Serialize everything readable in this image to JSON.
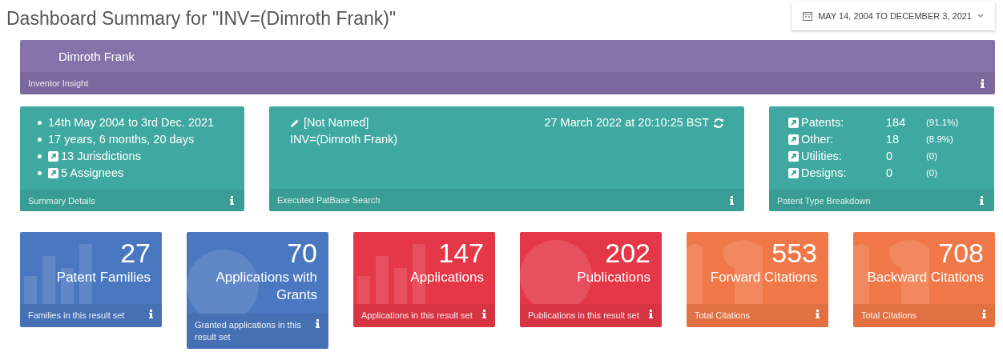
{
  "header": {
    "title": "Dashboard Summary for \"INV=(Dimroth Frank)\"",
    "date_range": "MAY 14, 2004 TO DECEMBER 3, 2021"
  },
  "inventor_panel": {
    "name": "Dimroth Frank",
    "footer": "Inventor Insight"
  },
  "summary_card": {
    "items": [
      {
        "text": "14th May 2004 to 3rd Dec. 2021",
        "link": false
      },
      {
        "text": "17 years, 6 months, 20 days",
        "link": false
      },
      {
        "text": "13 Jurisdictions",
        "link": true
      },
      {
        "text": "5 Assignees",
        "link": true
      }
    ],
    "footer": "Summary Details"
  },
  "search_card": {
    "name": "[Not Named]",
    "query": "INV=(Dimroth Frank)",
    "timestamp": "27 March 2022 at 20:10:25 BST",
    "footer": "Executed PatBase Search"
  },
  "type_card": {
    "rows": [
      {
        "label": "Patents:",
        "count": "184",
        "share": "(91.1%)"
      },
      {
        "label": "Other:",
        "count": "18",
        "share": "(8.9%)"
      },
      {
        "label": "Utilities:",
        "count": "0",
        "share": "(0)"
      },
      {
        "label": "Designs:",
        "count": "0",
        "share": "(0)"
      }
    ],
    "footer": "Patent Type Breakdown"
  },
  "stat_tiles": [
    {
      "value": "27",
      "label": "Patent Families",
      "footer": "Families in this result set",
      "color": "#4a78c0",
      "kind": "bars"
    },
    {
      "value": "70",
      "label": "Applications with Grants",
      "footer": "Granted applications in this result set",
      "color": "#4a78c0",
      "kind": "globe"
    },
    {
      "value": "147",
      "label": "Applications",
      "footer": "Applications in this result set",
      "color": "#e43848",
      "kind": "bars"
    },
    {
      "value": "202",
      "label": "Publications",
      "footer": "Publications in this result set",
      "color": "#e43848",
      "kind": "globe"
    },
    {
      "value": "553",
      "label": "Forward Citations",
      "footer": "Total Citations",
      "color": "#f07848",
      "kind": "quote"
    },
    {
      "value": "708",
      "label": "Backward Citations",
      "footer": "Total Citations",
      "color": "#f07848",
      "kind": "quote"
    }
  ]
}
